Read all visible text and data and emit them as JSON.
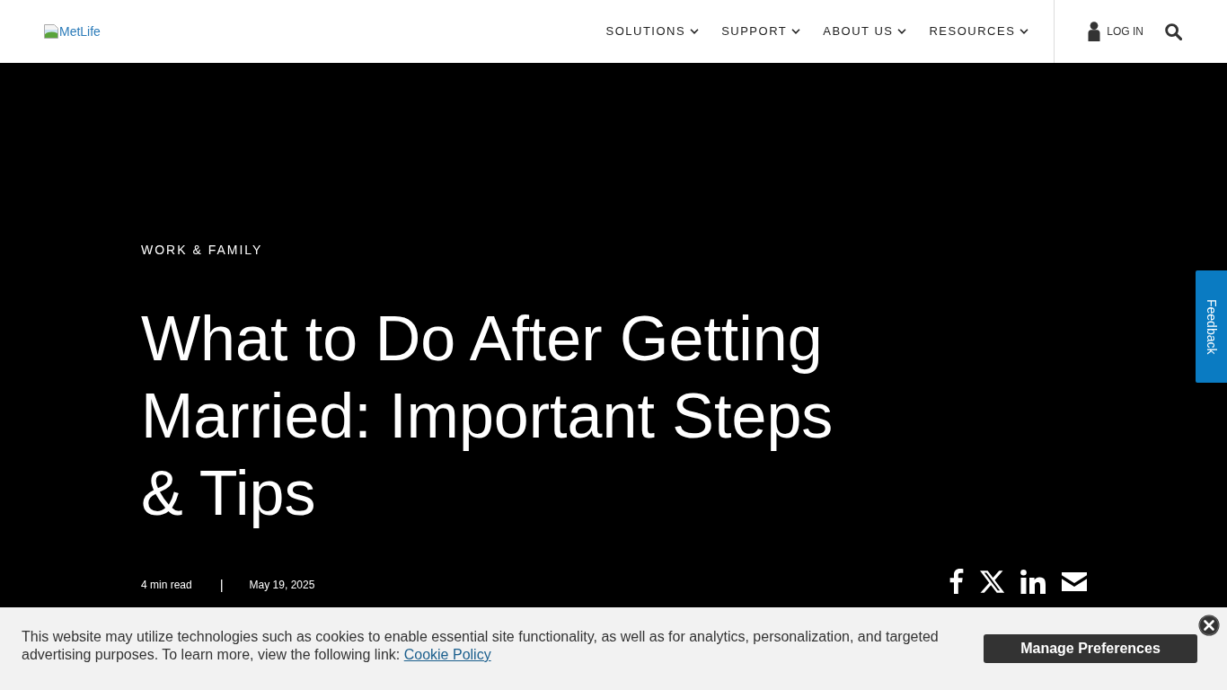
{
  "header": {
    "logo": {
      "alt_text": "MetLife"
    },
    "nav": [
      {
        "label": "SOLUTIONS"
      },
      {
        "label": "SUPPORT"
      },
      {
        "label": "ABOUT US"
      },
      {
        "label": "RESOURCES"
      }
    ],
    "login": {
      "label": "LOG IN"
    }
  },
  "hero": {
    "category": "WORK & FAMILY",
    "title": "What to Do After Getting Married: Important Steps & Tips",
    "read_time": "4 min read",
    "separator": "|",
    "date": "May 19, 2025",
    "share_links": [
      {
        "kind": "facebook"
      },
      {
        "kind": "x"
      },
      {
        "kind": "linkedin"
      },
      {
        "kind": "email"
      }
    ]
  },
  "feedback_tab": {
    "label": "Feedback"
  },
  "cookie_banner": {
    "message": "This website may utilize technologies such as cookies to enable essential site functionality, as well as for analytics, personalization, and targeted advertising purposes. To learn more, view the following link:",
    "link": "Cookie Policy",
    "button": "Manage Preferences"
  }
}
